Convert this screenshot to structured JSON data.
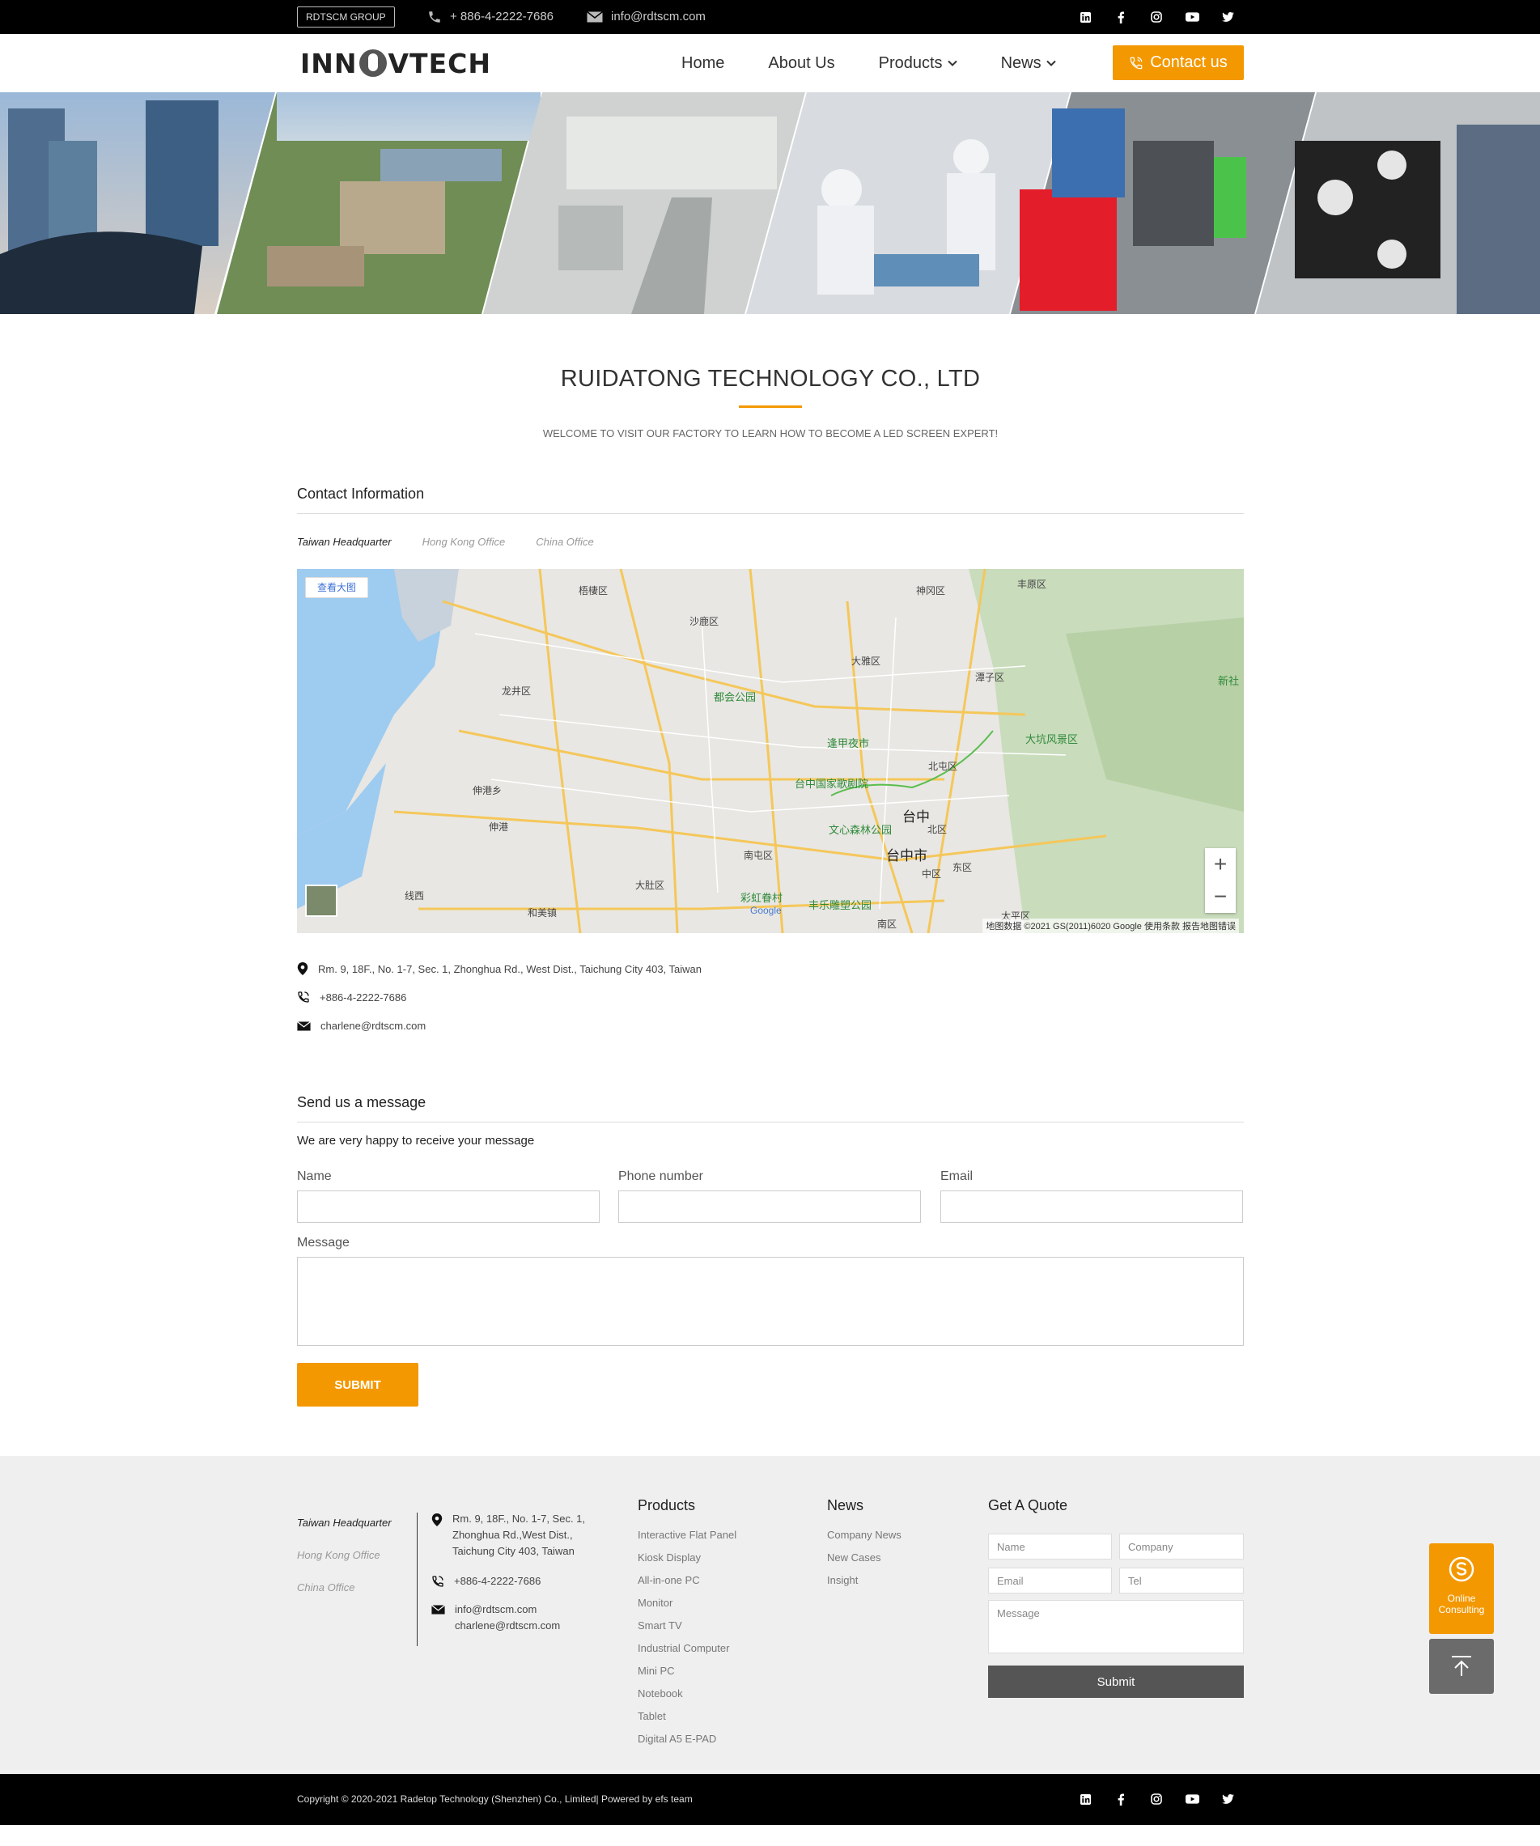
{
  "topbar": {
    "group": "RDTSCM GROUP",
    "phone": "+ 886-4-2222-7686",
    "email": "info@rdtscm.com",
    "social": [
      "linkedin-icon",
      "facebook-icon",
      "instagram-icon",
      "youtube-icon",
      "twitter-icon"
    ]
  },
  "nav": {
    "logo_left": "INN",
    "logo_right": "VTECH",
    "home": "Home",
    "about": "About Us",
    "products": "Products",
    "news": "News",
    "contact": "Contact us"
  },
  "header": {
    "title": "RUIDATONG TECHNOLOGY CO., LTD",
    "subtitle": "WELCOME TO VISIT OUR FACTORY TO LEARN HOW TO BECOME A LED SCREEN EXPERT!"
  },
  "contact_info": {
    "heading": "Contact Information",
    "tabs": [
      "Taiwan Headquarter",
      "Hong Kong Office",
      "China Office"
    ],
    "address": "Rm. 9, 18F., No. 1-7, Sec. 1, Zhonghua Rd., West Dist., Taichung City 403, Taiwan",
    "phone": "+886-4-2222-7686",
    "email": "charlene@rdtscm.com"
  },
  "map": {
    "view_large": "查看大图",
    "zoom_in": "+",
    "zoom_out": "−",
    "credit": "地图数据 ©2021 GS(2011)6020 Google   使用条款   报告地图错误",
    "labels": {
      "wuqi": "梧棲区",
      "shalu": "沙鹿区",
      "shengang": "神冈区",
      "fengyuan": "丰原区",
      "daya": "大雅区",
      "tanzi": "潭子区",
      "xinshe": "新社",
      "longjing": "龙井区",
      "duhui": "都会公园",
      "fengjia": "逢甲夜市",
      "dakeng": "大坑风景区",
      "beitun": "北屯区",
      "xxx": "台中国家歌剧院",
      "shengang2": "伸港乡",
      "shengang3": "伸港",
      "taichung": "台中",
      "north": "北区",
      "wenxin": "文心森林公园",
      "nantun": "南屯区",
      "city": "台中市",
      "east": "东区",
      "central": "中区",
      "dadu": "大肚区",
      "rainbow": "彩虹眷村",
      "fengle": "丰乐雕塑公园",
      "xianxi": "线西",
      "hemei": "和美镇",
      "south": "南区",
      "taiping": "太平区",
      "google": "Google"
    }
  },
  "message_form": {
    "heading": "Send us a message",
    "intro": "We are very happy to receive your message",
    "name_label": "Name",
    "phone_label": "Phone number",
    "email_label": "Email",
    "message_label": "Message",
    "submit": "SUBMIT"
  },
  "footer": {
    "tabs": [
      "Taiwan Headquarter",
      "Hong Kong Office",
      "China Office"
    ],
    "address_lines": [
      "Rm. 9, 18F., No. 1-7, Sec. 1,",
      "Zhonghua Rd.,West Dist.,",
      "Taichung City 403, Taiwan"
    ],
    "phone": "+886-4-2222-7686",
    "emails": [
      "info@rdtscm.com",
      "charlene@rdtscm.com"
    ],
    "products_title": "Products",
    "products": [
      "Interactive Flat Panel",
      "Kiosk Display",
      "All-in-one PC",
      "Monitor",
      "Smart TV",
      "Industrial Computer",
      "Mini PC",
      "Notebook",
      "Tablet",
      "Digital A5 E-PAD"
    ],
    "news_title": "News",
    "news": [
      "Company News",
      "New Cases",
      "Insight"
    ],
    "quote_title": "Get A Quote",
    "quote_name": "Name",
    "quote_company": "Company",
    "quote_email": "Email",
    "quote_tel": "Tel",
    "quote_message": "Message",
    "quote_submit": "Submit"
  },
  "bottom": {
    "copyright": "Copyright © 2020-2021 Radetop Technology (Shenzhen) Co., Limited| Powered by efs team"
  },
  "floating": {
    "consult_line1": "Online",
    "consult_line2": "Consulting"
  },
  "colors": {
    "accent": "#f39800",
    "topbar": "#000000",
    "footer_bg": "#efefef"
  }
}
